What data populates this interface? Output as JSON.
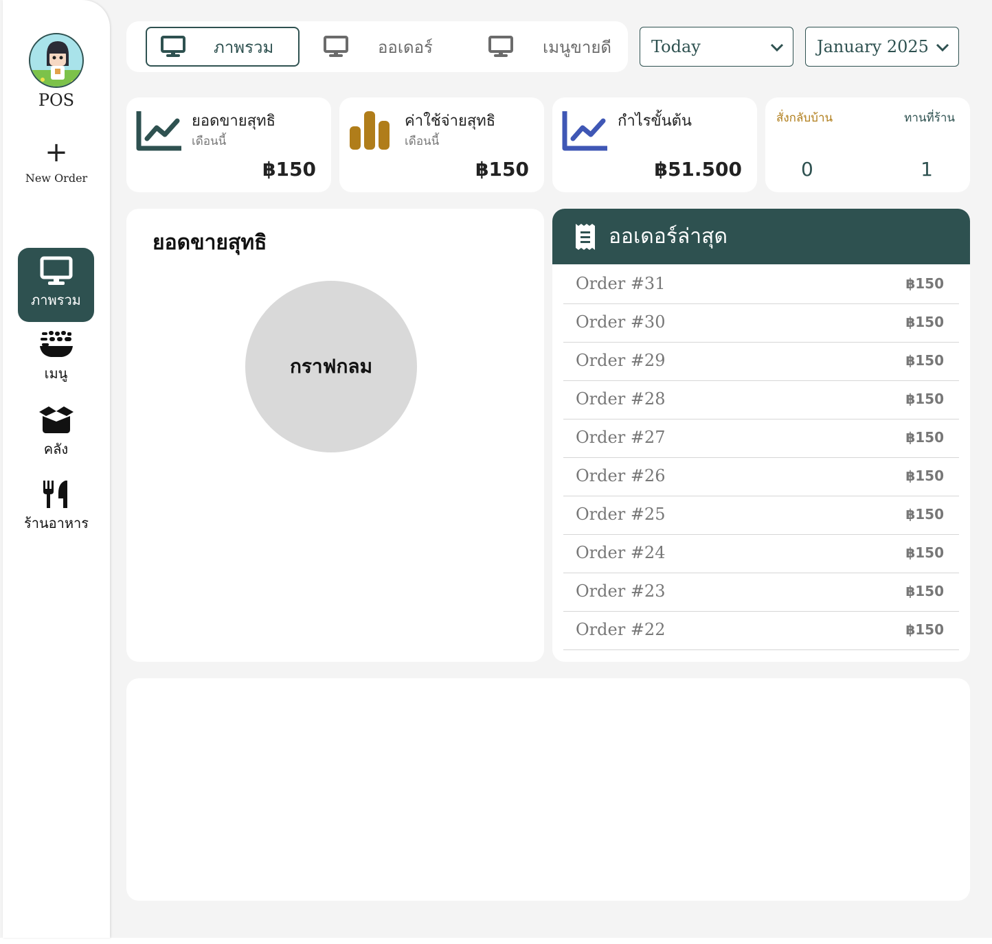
{
  "sidebar": {
    "brand": "POS",
    "new_order": {
      "icon": "plus-icon",
      "label": "New Order"
    },
    "nav": [
      {
        "icon": "monitor-icon",
        "label": "ภาพรวม",
        "active": true
      },
      {
        "icon": "bowl-food-icon",
        "label": "เมนู",
        "active": false
      },
      {
        "icon": "box-open-icon",
        "label": "คลัง",
        "active": false
      },
      {
        "icon": "utensils-icon",
        "label": "ร้านอาหาร",
        "active": false
      }
    ]
  },
  "tabs": [
    {
      "icon": "monitor-icon",
      "label": "ภาพรวม",
      "active": true
    },
    {
      "icon": "monitor-icon",
      "label": "ออเดอร์",
      "active": false
    },
    {
      "icon": "monitor-icon",
      "label": "เมนูขายดี",
      "active": false
    }
  ],
  "filters": {
    "period": {
      "value": "Today"
    },
    "month": {
      "value": "January 2025"
    }
  },
  "stats": [
    {
      "icon": "chart-line-icon",
      "icon_color": "#2e5150",
      "title": "ยอดขายสุทธิ",
      "sub": "เดือนนี้",
      "value": "฿150"
    },
    {
      "icon": "chart-bar-icon",
      "icon_color": "#b07d1a",
      "title": "ค่าใช้จ่ายสุทธิ",
      "sub": "เดือนนี้",
      "value": "฿150"
    },
    {
      "icon": "chart-line-icon",
      "icon_color": "#3f57b5",
      "title": "กำไรขั้นต้น",
      "sub": "",
      "value": "฿51.500"
    }
  ],
  "order_types": {
    "takeaway": {
      "label": "สั่งกลับบ้าน",
      "value": "0",
      "color": "#b07d1a"
    },
    "dine_in": {
      "label": "ทานที่ร้าน",
      "value": "1",
      "color": "#2e5150"
    }
  },
  "sales_panel": {
    "title": "ยอดขายสุทธิ",
    "pie_label": "กราฟกลม"
  },
  "orders_panel": {
    "title": "ออเดอร์ล่าสุด",
    "icon": "receipt-icon",
    "orders": [
      {
        "name": "Order #31",
        "price": "฿150"
      },
      {
        "name": "Order #30",
        "price": "฿150"
      },
      {
        "name": "Order #29",
        "price": "฿150"
      },
      {
        "name": "Order #28",
        "price": "฿150"
      },
      {
        "name": "Order #27",
        "price": "฿150"
      },
      {
        "name": "Order #26",
        "price": "฿150"
      },
      {
        "name": "Order #25",
        "price": "฿150"
      },
      {
        "name": "Order #24",
        "price": "฿150"
      },
      {
        "name": "Order #23",
        "price": "฿150"
      },
      {
        "name": "Order #22",
        "price": "฿150"
      }
    ]
  },
  "colors": {
    "primary": "#2e5150",
    "gold": "#b07d1a",
    "blue": "#3f57b5",
    "background": "#f4f4f4"
  }
}
